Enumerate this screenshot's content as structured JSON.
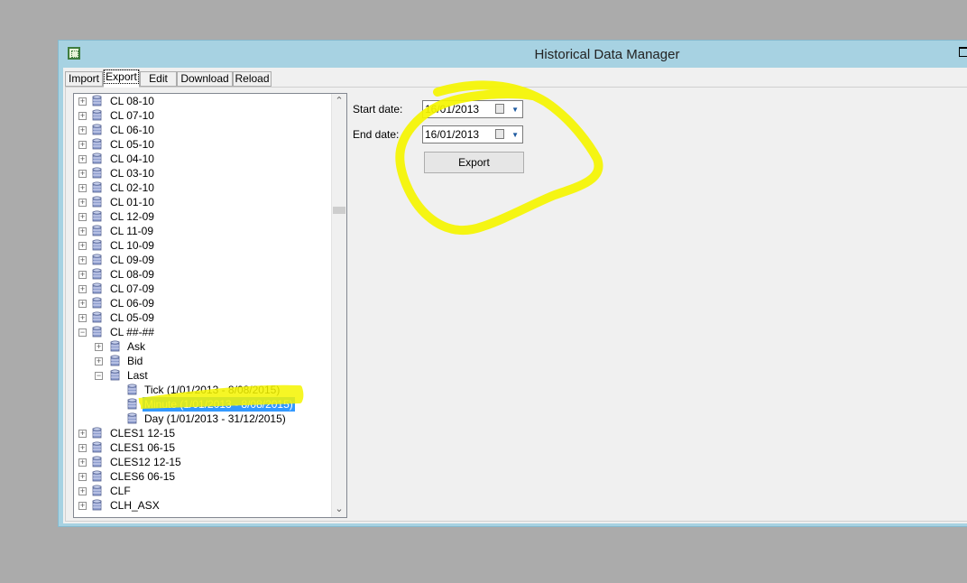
{
  "window": {
    "title": "Historical Data Manager"
  },
  "tabs": [
    {
      "label": "Import"
    },
    {
      "label": "Export"
    },
    {
      "label": "Edit"
    },
    {
      "label": "Download"
    },
    {
      "label": "Reload"
    }
  ],
  "tree": {
    "items": [
      {
        "label": "CL 08-10"
      },
      {
        "label": "CL 07-10"
      },
      {
        "label": "CL 06-10"
      },
      {
        "label": "CL 05-10"
      },
      {
        "label": "CL 04-10"
      },
      {
        "label": "CL 03-10"
      },
      {
        "label": "CL 02-10"
      },
      {
        "label": "CL 01-10"
      },
      {
        "label": "CL 12-09"
      },
      {
        "label": "CL 11-09"
      },
      {
        "label": "CL 10-09"
      },
      {
        "label": "CL 09-09"
      },
      {
        "label": "CL 08-09"
      },
      {
        "label": "CL 07-09"
      },
      {
        "label": "CL 06-09"
      },
      {
        "label": "CL 05-09"
      },
      {
        "label": "CL ##-##"
      },
      {
        "label": "Ask"
      },
      {
        "label": "Bid"
      },
      {
        "label": "Last"
      },
      {
        "label": "Tick (1/01/2013 - 8/08/2015)"
      },
      {
        "label": "Minute (1/01/2013 - 8/08/2015)"
      },
      {
        "label": "Day (1/01/2013 - 31/12/2015)"
      },
      {
        "label": "CLES1 12-15"
      },
      {
        "label": "CLES1 06-15"
      },
      {
        "label": "CLES12 12-15"
      },
      {
        "label": "CLES6 06-15"
      },
      {
        "label": "CLF"
      },
      {
        "label": "CLH_ASX"
      }
    ]
  },
  "export_form": {
    "start_label": "Start date:",
    "start_value": "16/01/2013",
    "end_label": "End date:",
    "end_value": "16/01/2013",
    "export_label": "Export"
  },
  "icons": {
    "expand": "plus-box-icon",
    "collapse": "minus-box-icon",
    "database": "database-icon",
    "calendar": "calendar-icon",
    "dropdown": "dropdown-arrow-icon"
  },
  "colors": {
    "highlighter": "#f5f500",
    "selection": "#3399ff",
    "window_frame": "#a7d2e2"
  }
}
